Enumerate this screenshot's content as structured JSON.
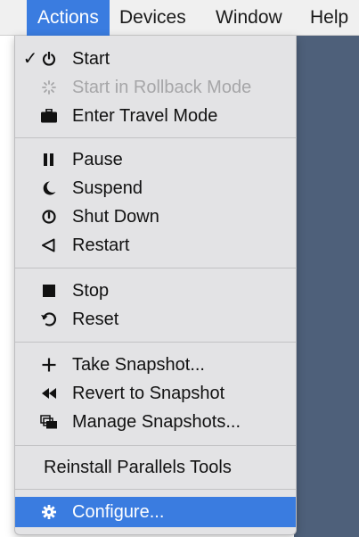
{
  "menubar": {
    "items": [
      {
        "label": "Actions",
        "active": true
      },
      {
        "label": "Devices"
      },
      {
        "label": "Window"
      },
      {
        "label": "Help"
      }
    ]
  },
  "menu": {
    "items": [
      {
        "label": "Start",
        "icon": "power-icon",
        "checked": true,
        "check_mark": "✓"
      },
      {
        "label": "Start in Rollback Mode",
        "icon": "spinner-icon",
        "disabled": true
      },
      {
        "label": "Enter Travel Mode",
        "icon": "briefcase-icon"
      },
      {
        "label": "Pause",
        "icon": "pause-icon"
      },
      {
        "label": "Suspend",
        "icon": "moon-icon"
      },
      {
        "label": "Shut Down",
        "icon": "shutdown-icon"
      },
      {
        "label": "Restart",
        "icon": "restart-icon"
      },
      {
        "label": "Stop",
        "icon": "stop-icon"
      },
      {
        "label": "Reset",
        "icon": "reset-icon"
      },
      {
        "label": "Take Snapshot...",
        "icon": "plus-icon"
      },
      {
        "label": "Revert to Snapshot",
        "icon": "rewind-icon"
      },
      {
        "label": "Manage Snapshots...",
        "icon": "snapshots-icon"
      },
      {
        "label": "Reinstall Parallels Tools"
      },
      {
        "label": "Configure...",
        "icon": "gear-icon",
        "highlighted": true
      }
    ]
  },
  "colors": {
    "accent": "#3a7ce0",
    "menu_bg": "#e3e3e5",
    "disabled_text": "#a6a6a8",
    "desktop_bg": "#4e607a"
  }
}
